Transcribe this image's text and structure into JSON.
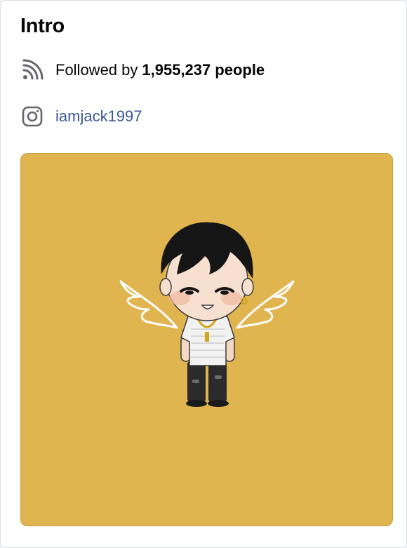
{
  "intro": {
    "title": "Intro",
    "followers": {
      "prefix": "Followed by",
      "count": "1,955,237",
      "suffix": "people",
      "icon": "rss-icon"
    },
    "instagram": {
      "handle": "iamjack1997",
      "icon": "instagram-icon"
    },
    "photo": {
      "background": "#e0b44f",
      "icon": "chibi-avatar-illustration"
    }
  }
}
